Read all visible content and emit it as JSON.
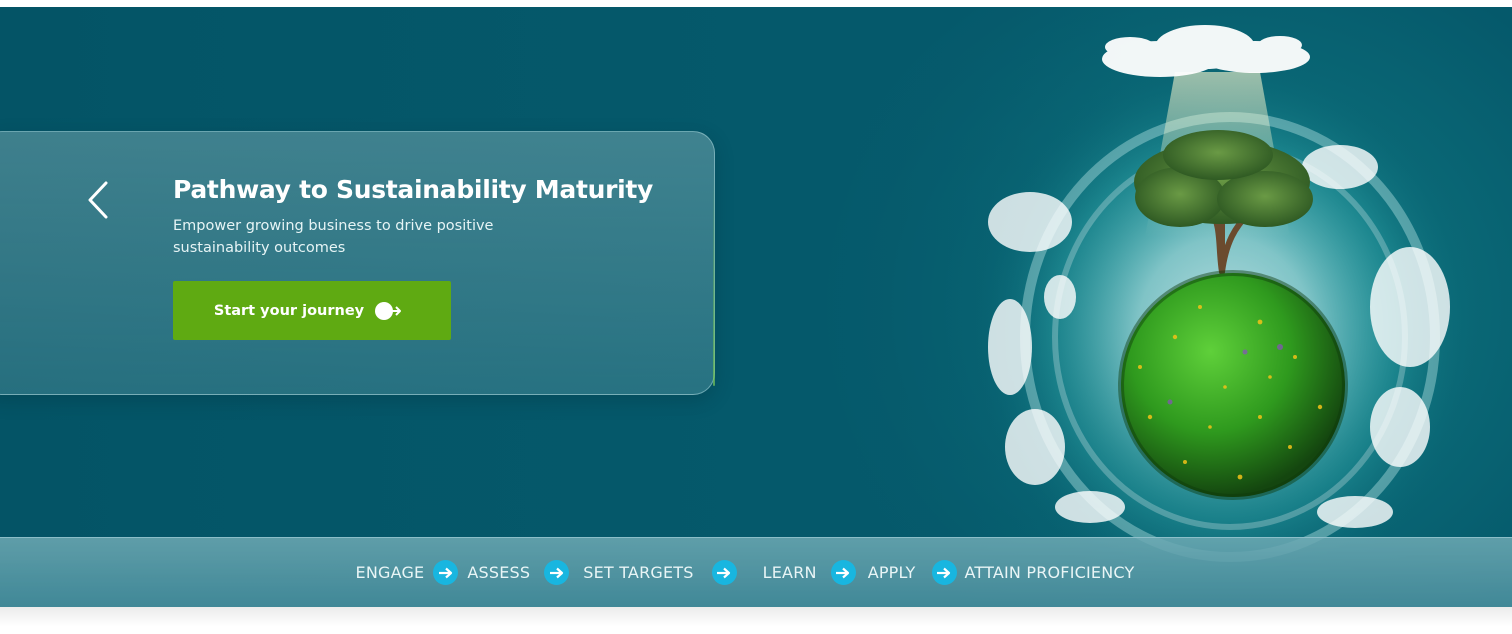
{
  "hero": {
    "title": "Pathway to Sustainability Maturity",
    "subtitle": "Empower growing business to drive positive sustainability outcomes",
    "cta_label": "Start your journey",
    "cta_icon": "arrow-exit-icon",
    "back_icon": "chevron-left-icon"
  },
  "steps": [
    {
      "label": "ENGAGE"
    },
    {
      "label": "ASSESS"
    },
    {
      "label": "SET TARGETS"
    },
    {
      "label": "LEARN"
    },
    {
      "label": "APPLY"
    },
    {
      "label": "ATTAIN PROFICIENCY"
    }
  ],
  "colors": {
    "background": "#05596b",
    "cta": "#5faa12",
    "step_arrow": "#18b6e0"
  }
}
